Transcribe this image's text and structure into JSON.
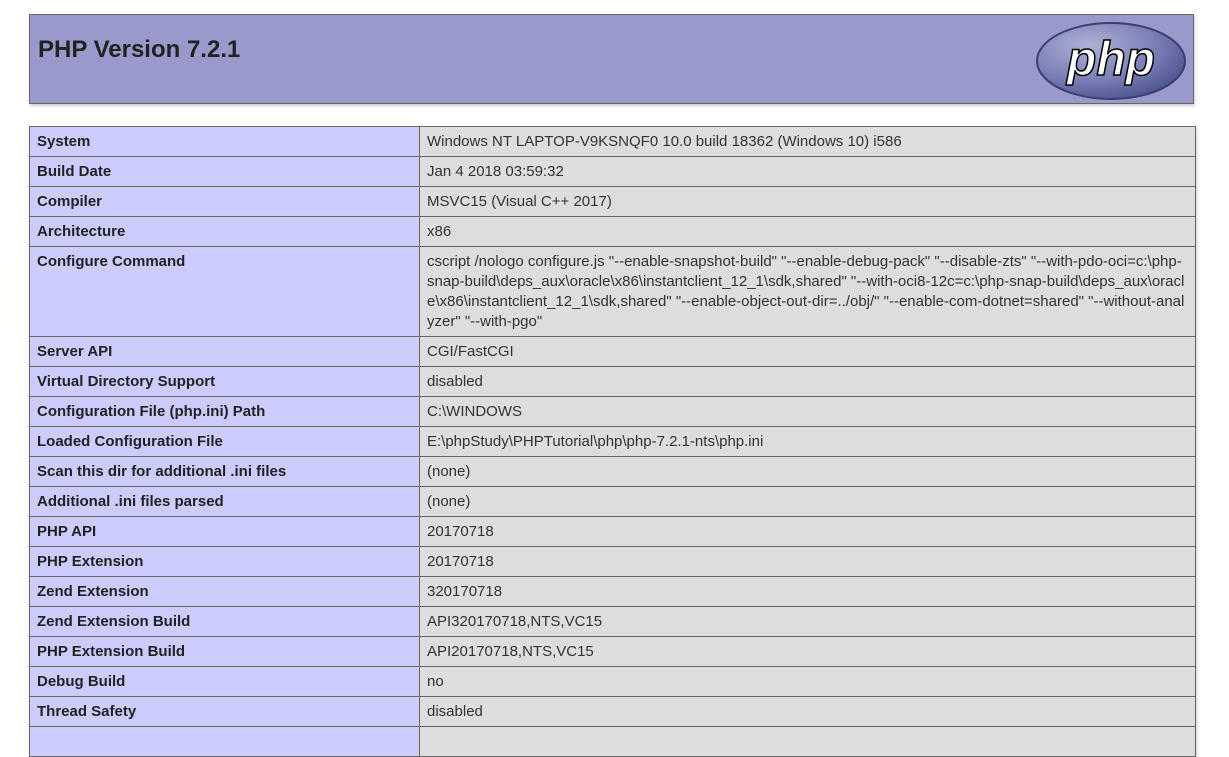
{
  "header": {
    "title": "PHP Version 7.2.1",
    "logo_text": "php",
    "background_color": "#9999cc"
  },
  "info_rows": [
    {
      "label": "System",
      "value": "Windows NT LAPTOP-V9KSNQF0 10.0 build 18362 (Windows 10) i586"
    },
    {
      "label": "Build Date",
      "value": "Jan 4 2018 03:59:32"
    },
    {
      "label": "Compiler",
      "value": "MSVC15 (Visual C++ 2017)"
    },
    {
      "label": "Architecture",
      "value": "x86"
    },
    {
      "label": "Configure Command",
      "value": "cscript /nologo configure.js \"--enable-snapshot-build\" \"--enable-debug-pack\" \"--disable-zts\" \"--with-pdo-oci=c:\\php-snap-build\\deps_aux\\oracle\\x86\\instantclient_12_1\\sdk,shared\" \"--with-oci8-12c=c:\\php-snap-build\\deps_aux\\oracle\\x86\\instantclient_12_1\\sdk,shared\" \"--enable-object-out-dir=../obj/\" \"--enable-com-dotnet=shared\" \"--without-analyzer\" \"--with-pgo\""
    },
    {
      "label": "Server API",
      "value": "CGI/FastCGI"
    },
    {
      "label": "Virtual Directory Support",
      "value": "disabled"
    },
    {
      "label": "Configuration File (php.ini) Path",
      "value": "C:\\WINDOWS"
    },
    {
      "label": "Loaded Configuration File",
      "value": "E:\\phpStudy\\PHPTutorial\\php\\php-7.2.1-nts\\php.ini"
    },
    {
      "label": "Scan this dir for additional .ini files",
      "value": "(none)"
    },
    {
      "label": "Additional .ini files parsed",
      "value": "(none)"
    },
    {
      "label": "PHP API",
      "value": "20170718"
    },
    {
      "label": "PHP Extension",
      "value": "20170718"
    },
    {
      "label": "Zend Extension",
      "value": "320170718"
    },
    {
      "label": "Zend Extension Build",
      "value": "API320170718,NTS,VC15"
    },
    {
      "label": "PHP Extension Build",
      "value": "API20170718,NTS,VC15"
    },
    {
      "label": "Debug Build",
      "value": "no"
    },
    {
      "label": "Thread Safety",
      "value": "disabled"
    },
    {
      "label": "",
      "value": ""
    }
  ],
  "colors": {
    "label_cell": "#ccccff",
    "value_cell": "#dddddd",
    "border": "#666666"
  }
}
